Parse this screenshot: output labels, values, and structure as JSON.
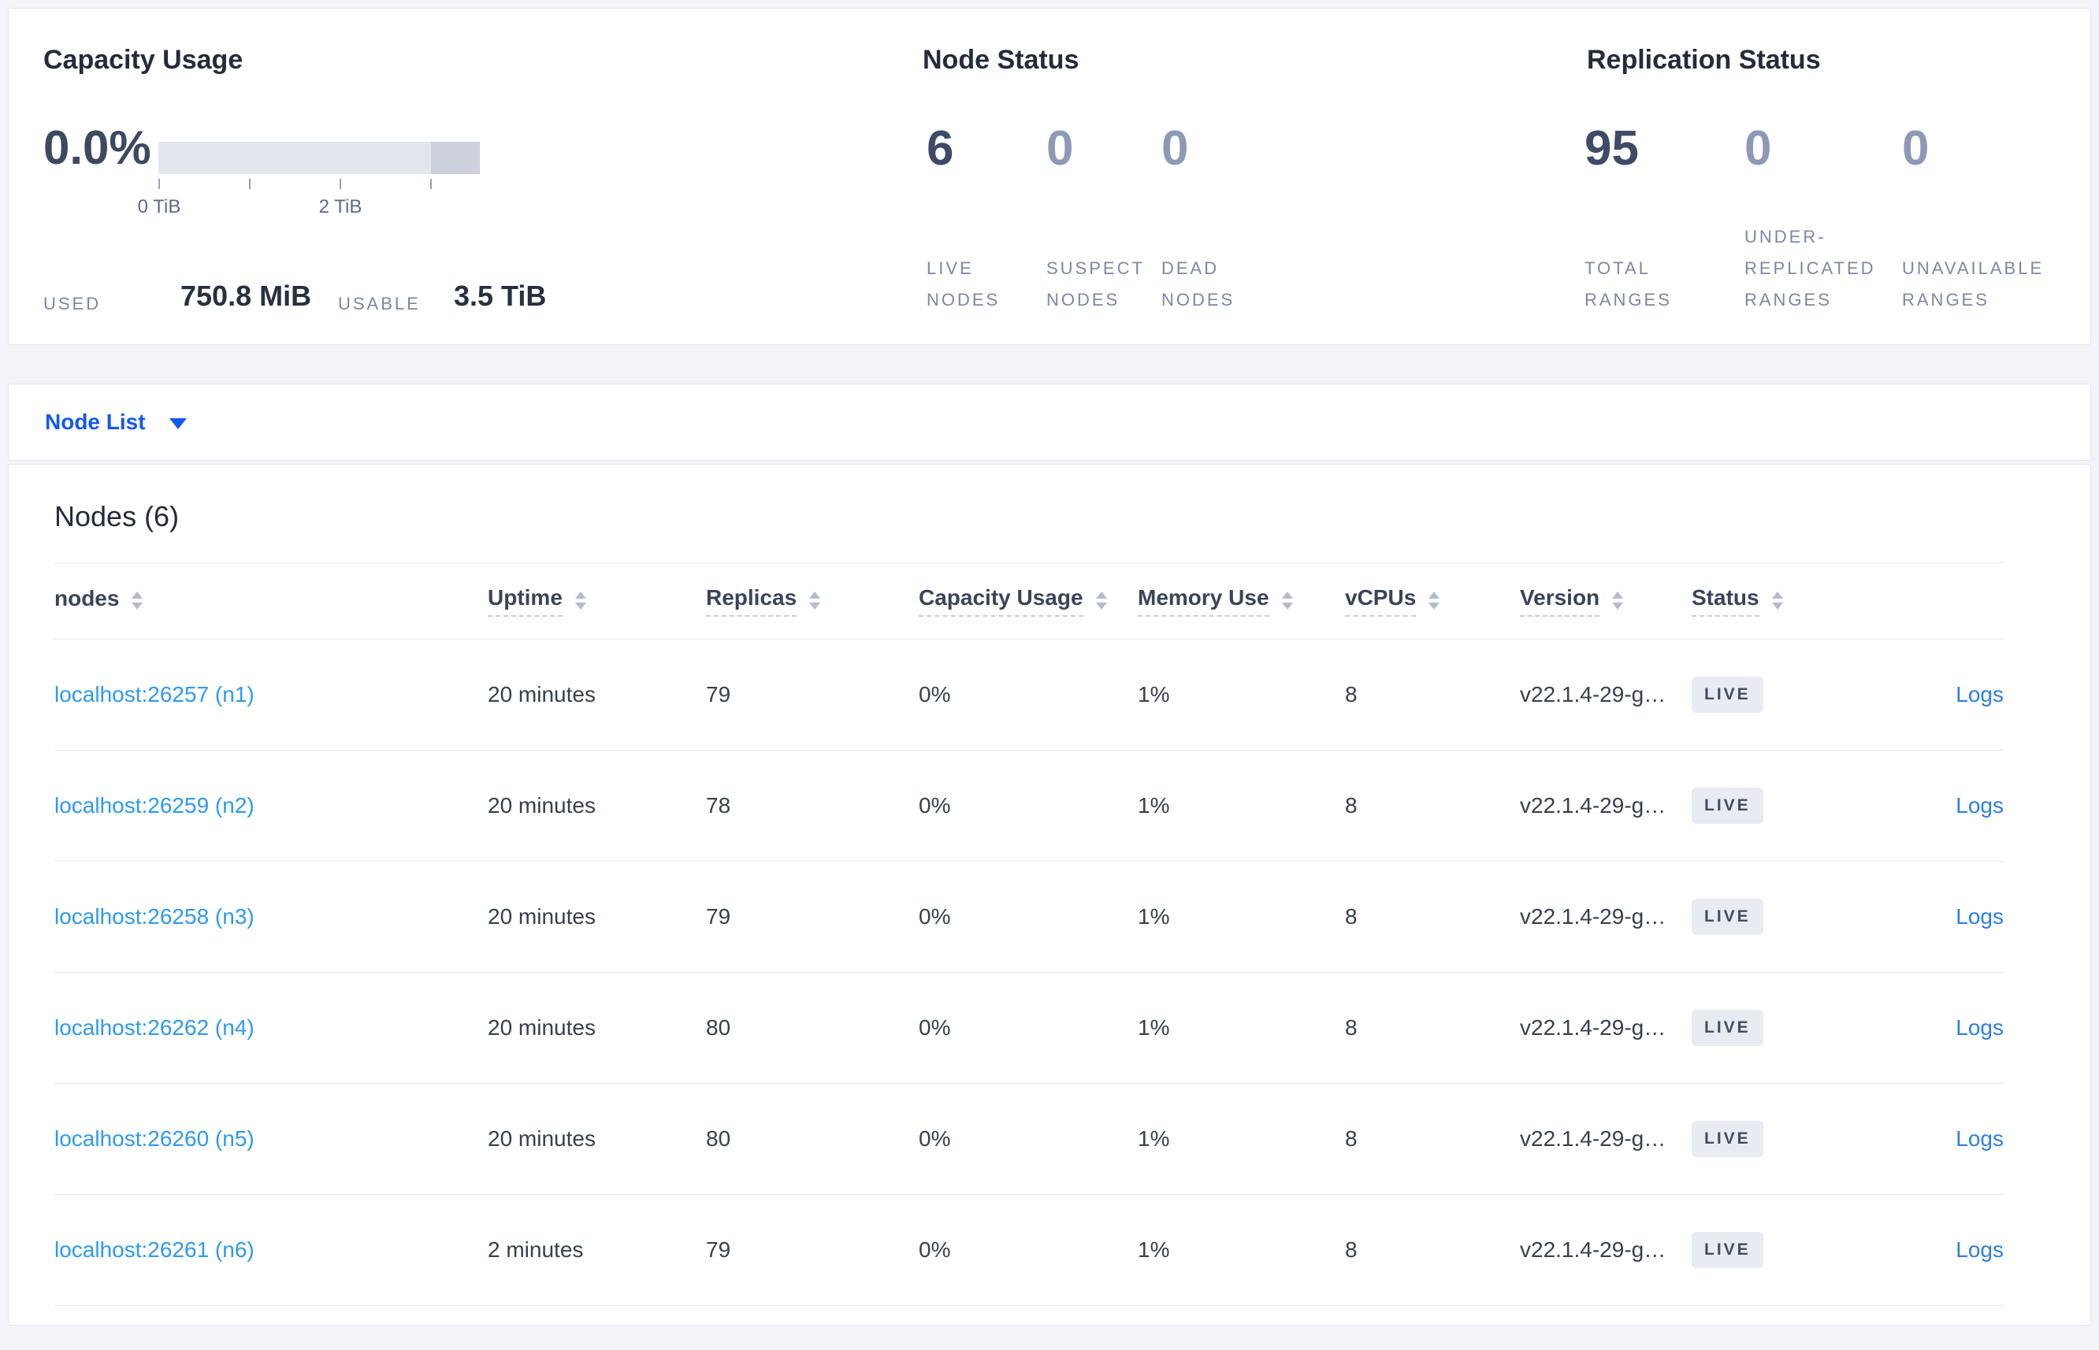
{
  "capacity": {
    "title": "Capacity Usage",
    "percent": "0.0%",
    "used_label": "USED",
    "used_value": "750.8 MiB",
    "usable_label": "USABLE",
    "usable_value": "3.5 TiB",
    "ticks": [
      "0 TiB",
      "2 TiB"
    ],
    "bar": {
      "track_color": "#e3e6ed",
      "segment_color": "#ccd1dc"
    }
  },
  "node_status": {
    "title": "Node Status",
    "stats": [
      {
        "value": "6",
        "label": "LIVE\nNODES"
      },
      {
        "value": "0",
        "label": "SUSPECT\nNODES"
      },
      {
        "value": "0",
        "label": "DEAD\nNODES"
      }
    ]
  },
  "replication_status": {
    "title": "Replication Status",
    "stats": [
      {
        "value": "95",
        "label": "TOTAL\nRANGES"
      },
      {
        "value": "0",
        "label": "UNDER-\nREPLICATED\nRANGES"
      },
      {
        "value": "0",
        "label": "UNAVAILABLE\nRANGES"
      }
    ]
  },
  "node_list": {
    "label": "Node List"
  },
  "table": {
    "title": "Nodes (6)",
    "logs_label": "Logs",
    "columns": [
      {
        "label": "nodes"
      },
      {
        "label": "Uptime"
      },
      {
        "label": "Replicas"
      },
      {
        "label": "Capacity Usage"
      },
      {
        "label": "Memory Use"
      },
      {
        "label": "vCPUs"
      },
      {
        "label": "Version"
      },
      {
        "label": "Status"
      }
    ],
    "rows": [
      {
        "node": "localhost:26257 (n1)",
        "uptime": "20 minutes",
        "replicas": "79",
        "capacity": "0%",
        "memory": "1%",
        "vcpus": "8",
        "version": "v22.1.4-29-g…",
        "status": "LIVE"
      },
      {
        "node": "localhost:26259 (n2)",
        "uptime": "20 minutes",
        "replicas": "78",
        "capacity": "0%",
        "memory": "1%",
        "vcpus": "8",
        "version": "v22.1.4-29-g…",
        "status": "LIVE"
      },
      {
        "node": "localhost:26258 (n3)",
        "uptime": "20 minutes",
        "replicas": "79",
        "capacity": "0%",
        "memory": "1%",
        "vcpus": "8",
        "version": "v22.1.4-29-g…",
        "status": "LIVE"
      },
      {
        "node": "localhost:26262 (n4)",
        "uptime": "20 minutes",
        "replicas": "80",
        "capacity": "0%",
        "memory": "1%",
        "vcpus": "8",
        "version": "v22.1.4-29-g…",
        "status": "LIVE"
      },
      {
        "node": "localhost:26260 (n5)",
        "uptime": "20 minutes",
        "replicas": "80",
        "capacity": "0%",
        "memory": "1%",
        "vcpus": "8",
        "version": "v22.1.4-29-g…",
        "status": "LIVE"
      },
      {
        "node": "localhost:26261 (n6)",
        "uptime": "2 minutes",
        "replicas": "79",
        "capacity": "0%",
        "memory": "1%",
        "vcpus": "8",
        "version": "v22.1.4-29-g…",
        "status": "LIVE"
      }
    ]
  },
  "colors": {
    "node_list_blue": "#1458f0",
    "node_link_blue": "#2d9af3",
    "logs_blue": "#2e7ee4",
    "badge_bg": "#e8ebf1",
    "page_bg": "#f2f4f9"
  }
}
